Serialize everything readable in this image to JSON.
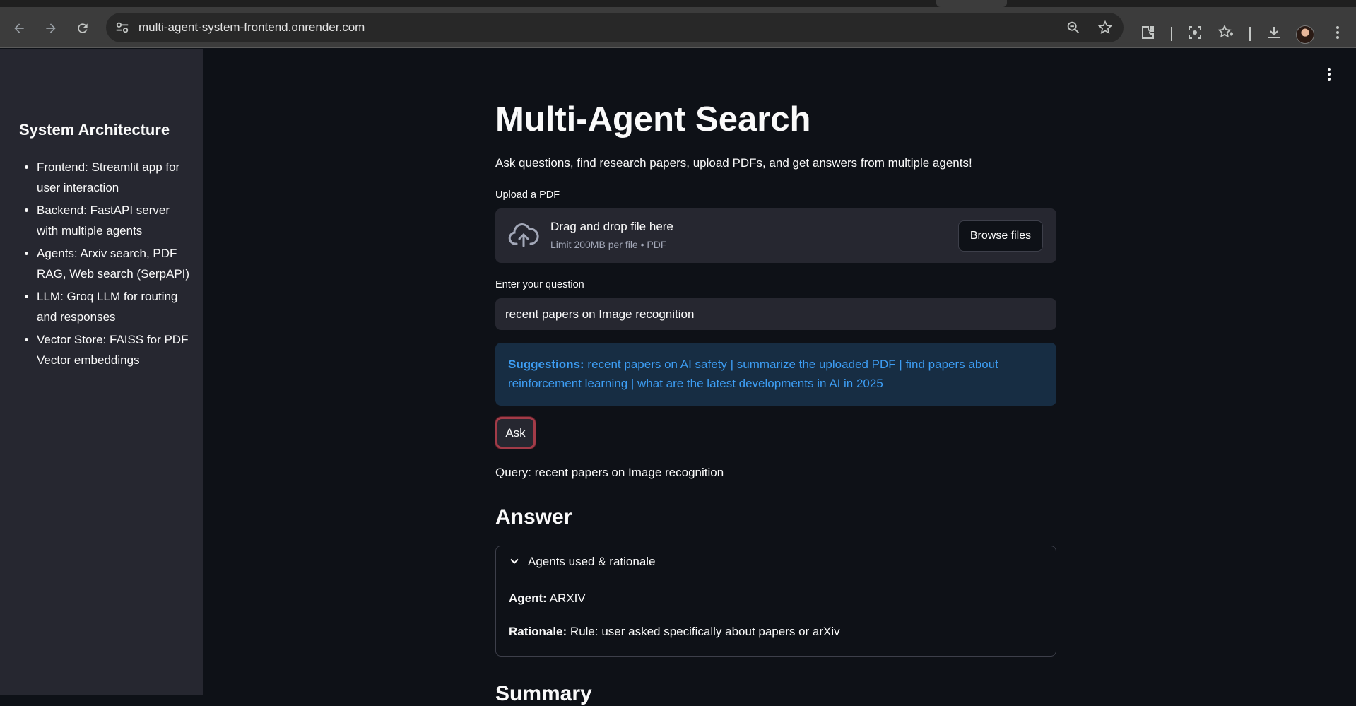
{
  "browser": {
    "url": "multi-agent-system-frontend.onrender.com"
  },
  "sidebar": {
    "heading": "System Architecture",
    "items": [
      "Frontend: Streamlit app for user interaction",
      "Backend: FastAPI server with multiple agents",
      "Agents: Arxiv search, PDF RAG, Web search (SerpAPI)",
      "LLM: Groq LLM for routing and responses",
      "Vector Store: FAISS for PDF Vector embeddings"
    ]
  },
  "main": {
    "title": "Multi-Agent Search",
    "intro": "Ask questions, find research papers, upload PDFs, and get answers from multiple agents!",
    "upload": {
      "label": "Upload a PDF",
      "dropzone_title": "Drag and drop file here",
      "dropzone_sub": "Limit 200MB per file • PDF",
      "browse_label": "Browse files"
    },
    "question": {
      "label": "Enter your question",
      "value": "recent papers on Image recognition"
    },
    "suggestions": {
      "prefix": "Suggestions:",
      "text": "recent papers on AI safety | summarize the uploaded PDF | find papers about reinforcement learning | what are the latest developments in AI in 2025"
    },
    "ask_label": "Ask",
    "query_line": "Query: recent papers on Image recognition",
    "answer_heading": "Answer",
    "expander": {
      "title": "Agents used & rationale",
      "agent_label": "Agent:",
      "agent_value": "ARXIV",
      "rationale_label": "Rationale:",
      "rationale_value": "Rule: user asked specifically about papers or arXiv"
    },
    "summary_heading": "Summary"
  },
  "colors": {
    "main_bg": "#0e1117",
    "sidebar_bg": "#262730",
    "info_bg": "#172d43",
    "info_text": "#3d9df3",
    "ask_border": "#a23b48"
  }
}
